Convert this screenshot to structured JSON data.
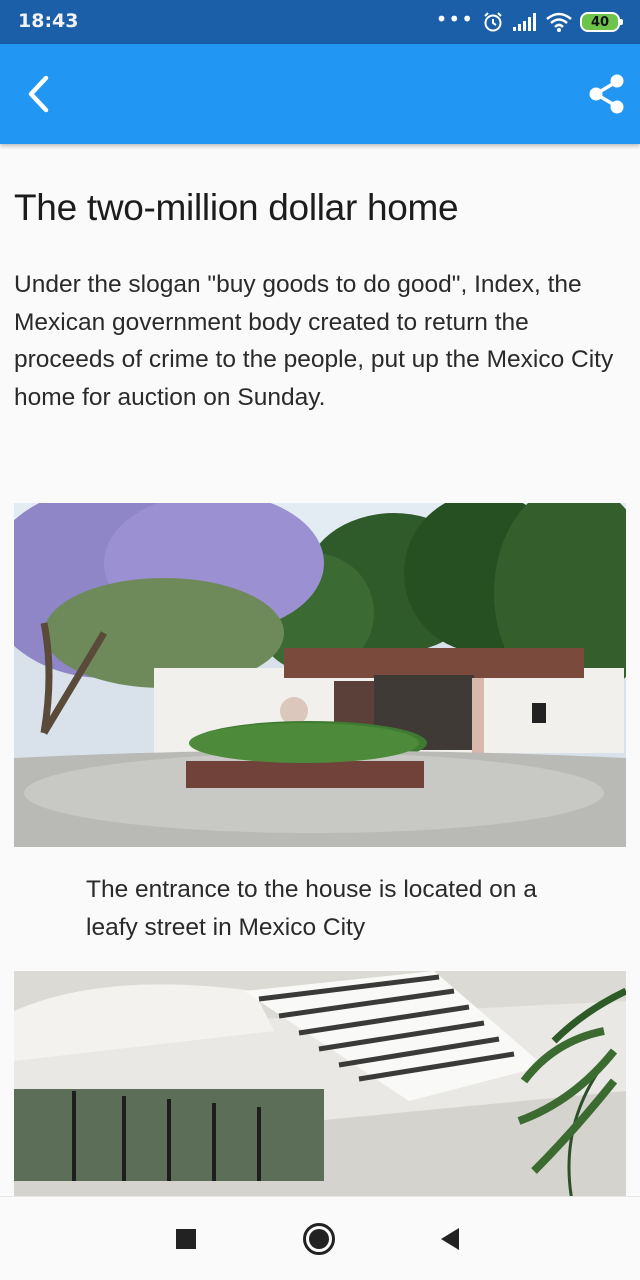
{
  "status_bar": {
    "time": "18:43",
    "battery": "40",
    "icons": [
      "more-dots-icon",
      "alarm-icon",
      "signal-icon",
      "wifi-icon",
      "battery-icon"
    ]
  },
  "app_bar": {
    "back_icon": "back-arrow-icon",
    "share_icon": "share-icon",
    "color": "#2196f3"
  },
  "article": {
    "title": "The two-million dollar home",
    "lead": "Under the slogan \"buy goods to do good\", Index, the Mexican government body created to return the proceeds of crime to the people, put up the Mexico City home for auction on Sunday.",
    "photos": [
      {
        "caption": "The entrance to the house is located on a leafy street in Mexico City"
      },
      {
        "caption": ""
      }
    ]
  },
  "nav_bar": {
    "icons": [
      "recents-square-icon",
      "home-circle-icon",
      "back-triangle-icon"
    ]
  }
}
